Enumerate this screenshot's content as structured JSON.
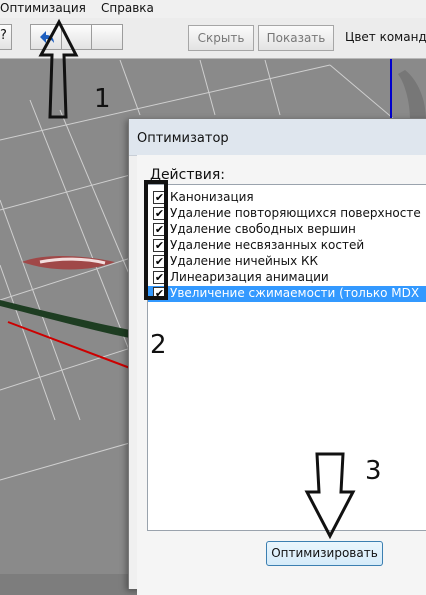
{
  "menubar": {
    "items": [
      "Оптимизация",
      "Справка"
    ]
  },
  "toolbar": {
    "hide_label": "Скрыть",
    "show_label": "Показать",
    "team_color_label": "Цвет команд"
  },
  "dialog": {
    "title": "Оптимизатор",
    "group_label": "Действия:",
    "actions": [
      {
        "label": "Канонизация",
        "checked": true,
        "selected": false
      },
      {
        "label": "Удаление повторяющихся поверхносте",
        "checked": true,
        "selected": false
      },
      {
        "label": "Удаление свободных вершин",
        "checked": true,
        "selected": false
      },
      {
        "label": "Удаление несвязанных костей",
        "checked": true,
        "selected": false
      },
      {
        "label": "Удаление ничейных КК",
        "checked": true,
        "selected": false
      },
      {
        "label": "Линеаризация анимации",
        "checked": true,
        "selected": false
      },
      {
        "label": "Увеличение сжимаемости (только MDX",
        "checked": true,
        "selected": true
      }
    ],
    "optimize_label": "Оптимизировать"
  },
  "annotations": {
    "step1": "1",
    "step2": "2",
    "step3": "3"
  },
  "colors": {
    "selection": "#3399ff",
    "button_border": "#3c7fb1",
    "viewport_bg": "#8a8a8a",
    "axis_red": "#cc0000",
    "axis_blue": "#0000cc"
  }
}
